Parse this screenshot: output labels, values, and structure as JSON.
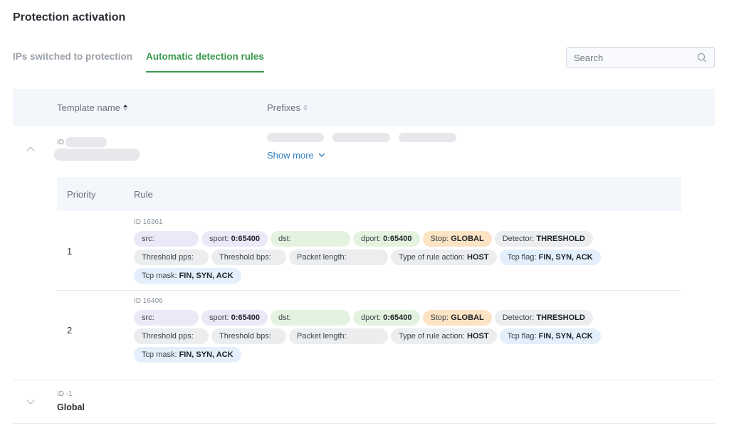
{
  "page_title": "Protection activation",
  "tabs": [
    {
      "label": "IPs switched to protection",
      "active": false
    },
    {
      "label": "Automatic detection rules",
      "active": true
    }
  ],
  "search": {
    "placeholder": "Search",
    "icon": "search-icon"
  },
  "table": {
    "columns": [
      {
        "label": "Template name",
        "sort": "ascending"
      },
      {
        "label": "Prefixes",
        "sort": "none"
      }
    ]
  },
  "templates": [
    {
      "id_prefix": "ID",
      "expanded": true,
      "show_more": "Show more",
      "subtable": {
        "columns": [
          "Priority",
          "Rule"
        ],
        "rows": [
          {
            "priority": "1",
            "rule_id": "ID 16361",
            "chips": {
              "src": "src:",
              "sport_label": "sport: ",
              "sport_value": "0:65400",
              "dst": "dst:",
              "dport_label": "dport: ",
              "dport_value": "0:65400",
              "stop_label": "Stop: ",
              "stop_value": "GLOBAL",
              "detector_label": "Detector: ",
              "detector_value": "THRESHOLD",
              "threshold_pps": "Threshold pps:",
              "threshold_bps": "Threshold bps:",
              "packet_length": "Packet length:",
              "rule_action_label": "Type of rule action: ",
              "rule_action_value": "HOST",
              "tcp_flag_label": "Tcp flag: ",
              "tcp_flag_value": "FIN, SYN, ACK",
              "tcp_mask_label": "Tcp mask: ",
              "tcp_mask_value": "FIN, SYN, ACK"
            }
          },
          {
            "priority": "2",
            "rule_id": "ID 16406",
            "chips": {
              "src": "src:",
              "sport_label": "sport: ",
              "sport_value": "0:65400",
              "dst": "dst:",
              "dport_label": "dport: ",
              "dport_value": "0:65400",
              "stop_label": "Stop: ",
              "stop_value": "GLOBAL",
              "detector_label": "Detector: ",
              "detector_value": "THRESHOLD",
              "threshold_pps": "Threshold pps:",
              "threshold_bps": "Threshold bps:",
              "packet_length": "Packet length:",
              "rule_action_label": "Type of rule action: ",
              "rule_action_value": "HOST",
              "tcp_flag_label": "Tcp flag: ",
              "tcp_flag_value": "FIN, SYN, ACK",
              "tcp_mask_label": "Tcp mask: ",
              "tcp_mask_value": "FIN, SYN, ACK"
            }
          }
        ]
      }
    },
    {
      "id_label": "ID -1",
      "name": "Global",
      "expanded": false
    }
  ],
  "colors": {
    "accent_green": "#3a9a4e",
    "link_blue": "#2f7fc1",
    "chip_purple": "#ebe8f7",
    "chip_green": "#e4f3df",
    "chip_orange": "#fbe3c3",
    "chip_gray": "#ebedef",
    "chip_blue": "#e3effb"
  }
}
